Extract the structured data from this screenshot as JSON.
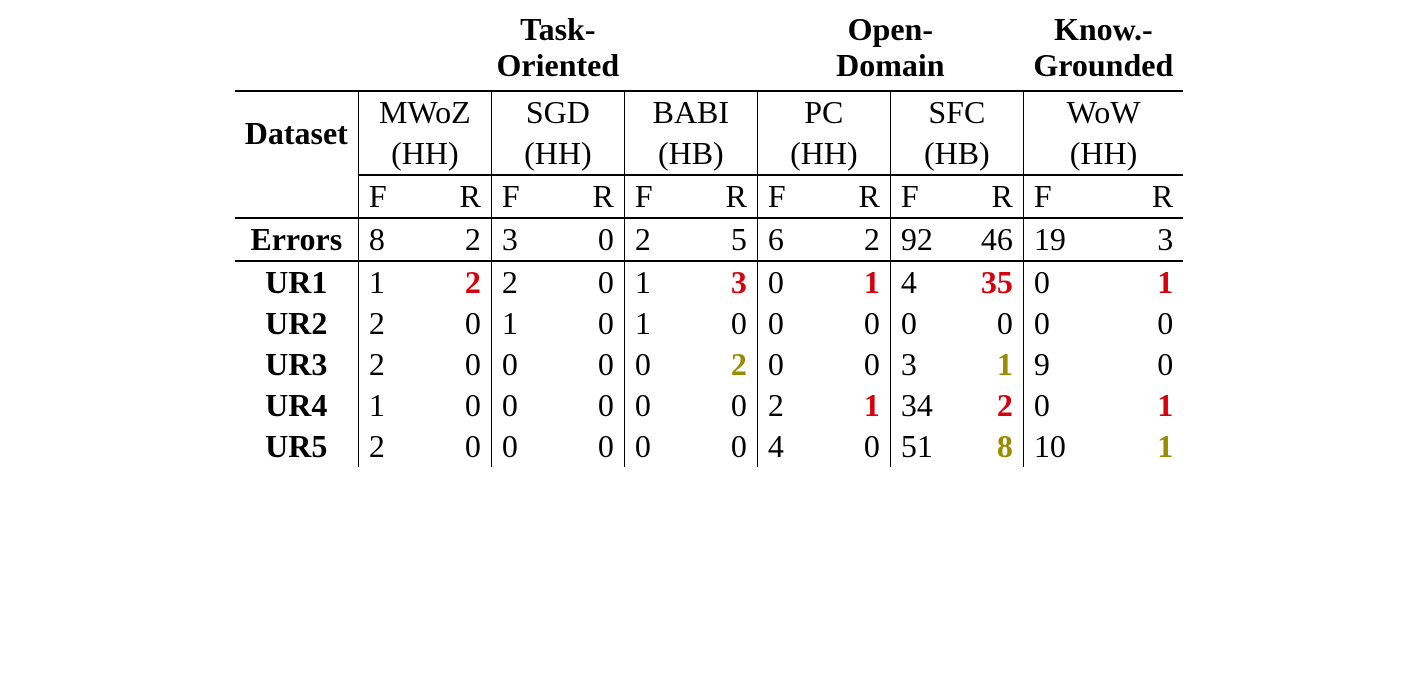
{
  "chart_data": {
    "type": "table",
    "title": "",
    "super_headers": [
      "Task-Oriented",
      "Open-Domain",
      "Know.-Grounded"
    ],
    "datasets": [
      {
        "name": "MWoZ",
        "type": "(HH)",
        "group": "Task-Oriented"
      },
      {
        "name": "SGD",
        "type": "(HH)",
        "group": "Task-Oriented"
      },
      {
        "name": "BABI",
        "type": "(HB)",
        "group": "Task-Oriented"
      },
      {
        "name": "PC",
        "type": "(HH)",
        "group": "Open-Domain"
      },
      {
        "name": "SFC",
        "type": "(HB)",
        "group": "Open-Domain"
      },
      {
        "name": "WoW",
        "type": "(HH)",
        "group": "Know.-Grounded"
      }
    ],
    "subcols": [
      "F",
      "R"
    ],
    "row_label_header": "Dataset",
    "rows": [
      {
        "label": "Errors",
        "values": [
          8,
          2,
          3,
          0,
          2,
          5,
          6,
          2,
          92,
          46,
          19,
          3
        ]
      },
      {
        "label": "UR1",
        "values": [
          1,
          2,
          2,
          0,
          1,
          3,
          0,
          1,
          4,
          35,
          0,
          1
        ]
      },
      {
        "label": "UR2",
        "values": [
          2,
          0,
          1,
          0,
          1,
          0,
          0,
          0,
          0,
          0,
          0,
          0
        ]
      },
      {
        "label": "UR3",
        "values": [
          2,
          0,
          0,
          0,
          0,
          2,
          0,
          0,
          3,
          1,
          9,
          0
        ]
      },
      {
        "label": "UR4",
        "values": [
          1,
          0,
          0,
          0,
          0,
          0,
          2,
          1,
          34,
          2,
          0,
          1
        ]
      },
      {
        "label": "UR5",
        "values": [
          2,
          0,
          0,
          0,
          0,
          0,
          4,
          0,
          51,
          8,
          10,
          1
        ]
      }
    ],
    "highlight": {
      "red": [
        [
          1,
          1
        ],
        [
          1,
          5
        ],
        [
          1,
          7
        ],
        [
          1,
          9
        ],
        [
          4,
          7
        ],
        [
          4,
          9
        ],
        [
          4,
          11
        ]
      ],
      "olive": [
        [
          3,
          5
        ],
        [
          3,
          9
        ],
        [
          5,
          9
        ],
        [
          5,
          11
        ]
      ]
    }
  },
  "hdr": {
    "task1": "Task-",
    "task2": "Oriented",
    "open1": "Open-",
    "open2": "Domain",
    "know1": "Know.-",
    "know2": "Grounded",
    "dataset": "Dataset",
    "mwoz": "MWoZ",
    "mwoz_t": "(HH)",
    "sgd": "SGD",
    "sgd_t": "(HH)",
    "babi": "BABI",
    "babi_t": "(HB)",
    "pc": "PC",
    "pc_t": "(HH)",
    "sfc": "SFC",
    "sfc_t": "(HB)",
    "wow": "WoW",
    "wow_t": "(HH)",
    "F": "F",
    "R": "R"
  },
  "rows": {
    "errors": {
      "label": "Errors",
      "v": [
        "8",
        "2",
        "3",
        "0",
        "2",
        "5",
        "6",
        "2",
        "92",
        "46",
        "19",
        "3"
      ]
    },
    "ur1": {
      "label": "UR1",
      "v": [
        "1",
        "2",
        "2",
        "0",
        "1",
        "3",
        "0",
        "1",
        "4",
        "35",
        "0",
        "1"
      ]
    },
    "ur2": {
      "label": "UR2",
      "v": [
        "2",
        "0",
        "1",
        "0",
        "1",
        "0",
        "0",
        "0",
        "0",
        "0",
        "0",
        "0"
      ]
    },
    "ur3": {
      "label": "UR3",
      "v": [
        "2",
        "0",
        "0",
        "0",
        "0",
        "2",
        "0",
        "0",
        "3",
        "1",
        "9",
        "0"
      ]
    },
    "ur4": {
      "label": "UR4",
      "v": [
        "1",
        "0",
        "0",
        "0",
        "0",
        "0",
        "2",
        "1",
        "34",
        "2",
        "0",
        "1"
      ]
    },
    "ur5": {
      "label": "UR5",
      "v": [
        "2",
        "0",
        "0",
        "0",
        "0",
        "0",
        "4",
        "0",
        "51",
        "8",
        "10",
        "1"
      ]
    }
  }
}
